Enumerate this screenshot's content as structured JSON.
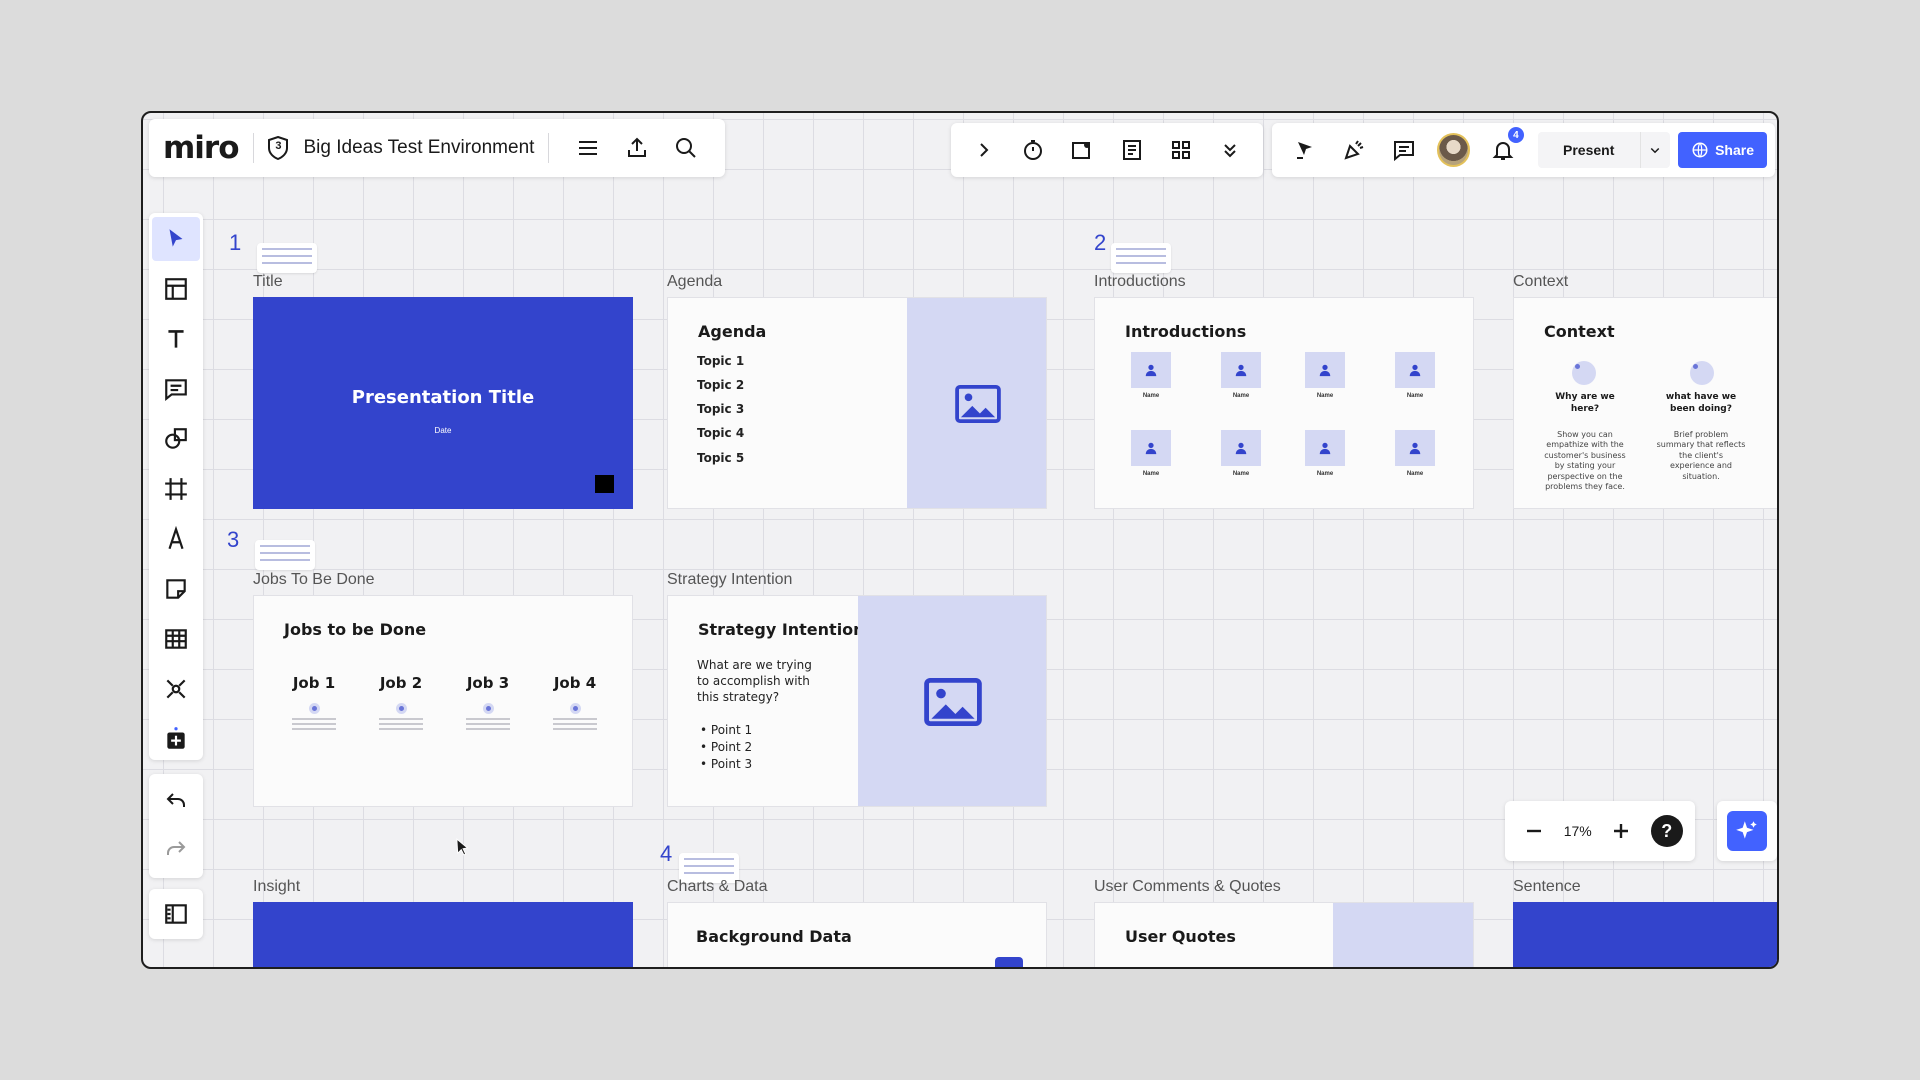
{
  "app": {
    "logo": "miro",
    "badge_number": "3",
    "board_title": "Big Ideas Test Environment"
  },
  "header": {
    "present_label": "Present",
    "share_label": "Share",
    "notification_count": "4"
  },
  "frames": {
    "title": {
      "step": "1",
      "label": "Title",
      "heading": "Presentation Title",
      "subtitle": "Date"
    },
    "agenda": {
      "label": "Agenda",
      "heading": "Agenda",
      "topics": [
        "Topic 1",
        "Topic 2",
        "Topic 3",
        "Topic 4",
        "Topic 5"
      ]
    },
    "introductions": {
      "step": "2",
      "label": "Introductions",
      "heading": "Introductions",
      "person_name": "Name"
    },
    "context": {
      "label": "Context",
      "heading": "Context",
      "col1_title": "Why are we here?",
      "col1_body": "Show you can empathize with the customer's business by stating your perspective on the problems they face.",
      "col2_title": "what have we been doing?",
      "col2_body": "Brief problem summary that reflects the client's experience and situation."
    },
    "jobs": {
      "step": "3",
      "label": "Jobs To Be Done",
      "heading": "Jobs to be Done",
      "jobs": [
        "Job 1",
        "Job 2",
        "Job 3",
        "Job 4"
      ]
    },
    "strategy": {
      "label": "Strategy Intention",
      "heading": "Strategy Intention",
      "question": "What are we trying to accomplish with this strategy?",
      "points": [
        "Point 1",
        "Point 2",
        "Point 3"
      ]
    },
    "insight": {
      "label": "Insight"
    },
    "charts": {
      "step": "4",
      "label": "Charts & Data",
      "heading": "Background Data"
    },
    "quotes": {
      "label": "User Comments & Quotes",
      "heading": "User Quotes"
    },
    "sentence": {
      "label": "Sentence"
    }
  },
  "zoom": {
    "value": "17%",
    "help": "?"
  },
  "colors": {
    "accent": "#4262ff",
    "frame_blue": "#3344cc",
    "image_tint": "#d4d8f3"
  }
}
